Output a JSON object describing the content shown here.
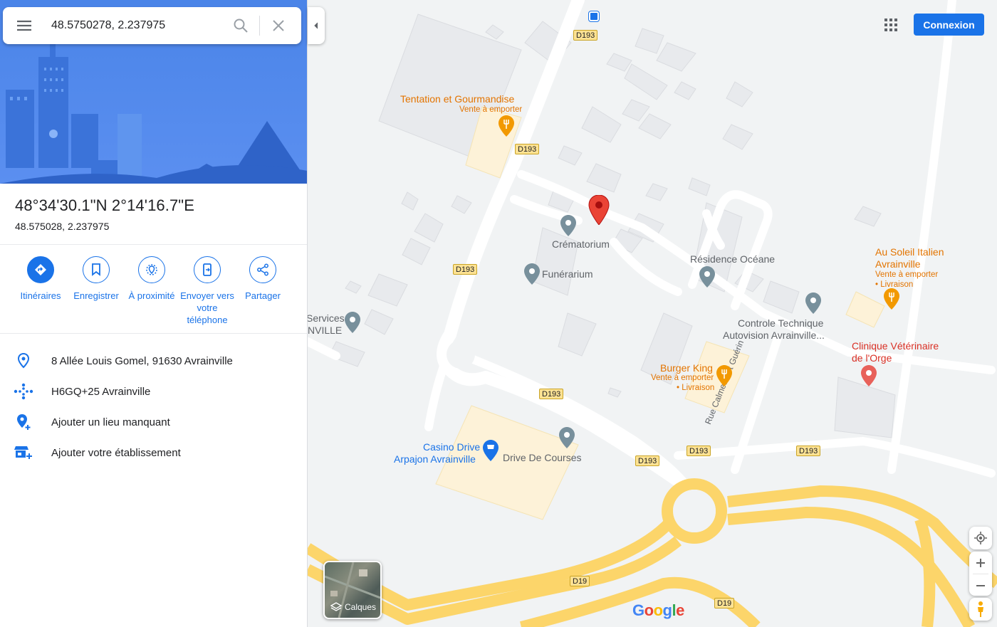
{
  "search": {
    "value": "48.5750278, 2.237975"
  },
  "place": {
    "dms": "48°34'30.1\"N 2°14'16.7\"E",
    "decimal": "48.575028, 2.237975"
  },
  "actions": [
    {
      "label": "Itinéraires"
    },
    {
      "label": "Enregistrer"
    },
    {
      "label": "À proximité"
    },
    {
      "label": "Envoyer vers votre téléphone"
    },
    {
      "label": "Partager"
    }
  ],
  "info": {
    "address": "8 Allée Louis Gomel, 91630 Avrainville",
    "plus_code": "H6GQ+25 Avrainville",
    "add_missing": "Ajouter un lieu manquant",
    "add_business": "Ajouter votre établissement"
  },
  "header": {
    "connexion_label": "Connexion"
  },
  "layers": {
    "label": "Calques"
  },
  "logo": "Google",
  "map": {
    "roads": [
      "D193",
      "D193",
      "D193",
      "D193",
      "D193",
      "D193",
      "D193",
      "D19",
      "D19"
    ],
    "street": "Rue Calmette et Guérin",
    "pois": {
      "tentation": "Tentation et Gourmandise",
      "tentation_sub": "Vente à emporter",
      "crematorium": "Crématorium",
      "funerarium": "Funérarium",
      "residence": "Résidence Océane",
      "soleil_1": "Au Soleil Italien",
      "soleil_2": "Avrainville",
      "soleil_sub1": "Vente à emporter",
      "soleil_sub2": "• Livraison",
      "services_1": "Services",
      "services_2": "NVILLE",
      "controle_1": "Controle Technique",
      "controle_2": "Autovision Avrainville...",
      "burger": "Burger King",
      "burger_sub1": "Vente à emporter",
      "burger_sub2": "• Livraison",
      "clinique_1": "Clinique Vétérinaire",
      "clinique_2": "de l'Orge",
      "casino_1": "Casino Drive",
      "casino_2": "Arpajon Avrainville",
      "drive": "Drive De Courses"
    }
  },
  "colors": {
    "accent": "#1a73e8",
    "marker": "#ea4335",
    "food": "#e37400",
    "road_major": "#fcd56a",
    "poi_pin": "#78909c"
  }
}
